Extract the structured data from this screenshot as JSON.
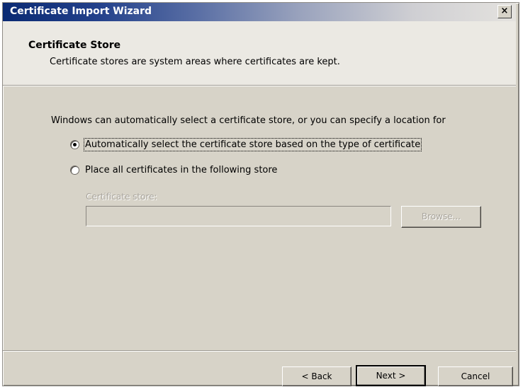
{
  "window": {
    "title": "Certificate Import Wizard",
    "close_glyph": "×"
  },
  "header": {
    "title": "Certificate Store",
    "description": "Certificate stores are system areas where certificates are kept."
  },
  "body": {
    "intro": "Windows can automatically select a certificate store, or you can specify a location for",
    "options": [
      {
        "label": "Automatically select the certificate store based on the type of certificate",
        "selected": true
      },
      {
        "label": "Place all certificates in the following store",
        "selected": false
      }
    ],
    "store_label": "Certificate store:",
    "store_value": "",
    "browse_label": "Browse..."
  },
  "footer": {
    "back_label": "< Back",
    "next_label": "Next >",
    "cancel_label": "Cancel"
  },
  "colors": {
    "dialog_bg": "#d7d3c8",
    "title_gradient_start": "#0a2a73"
  }
}
